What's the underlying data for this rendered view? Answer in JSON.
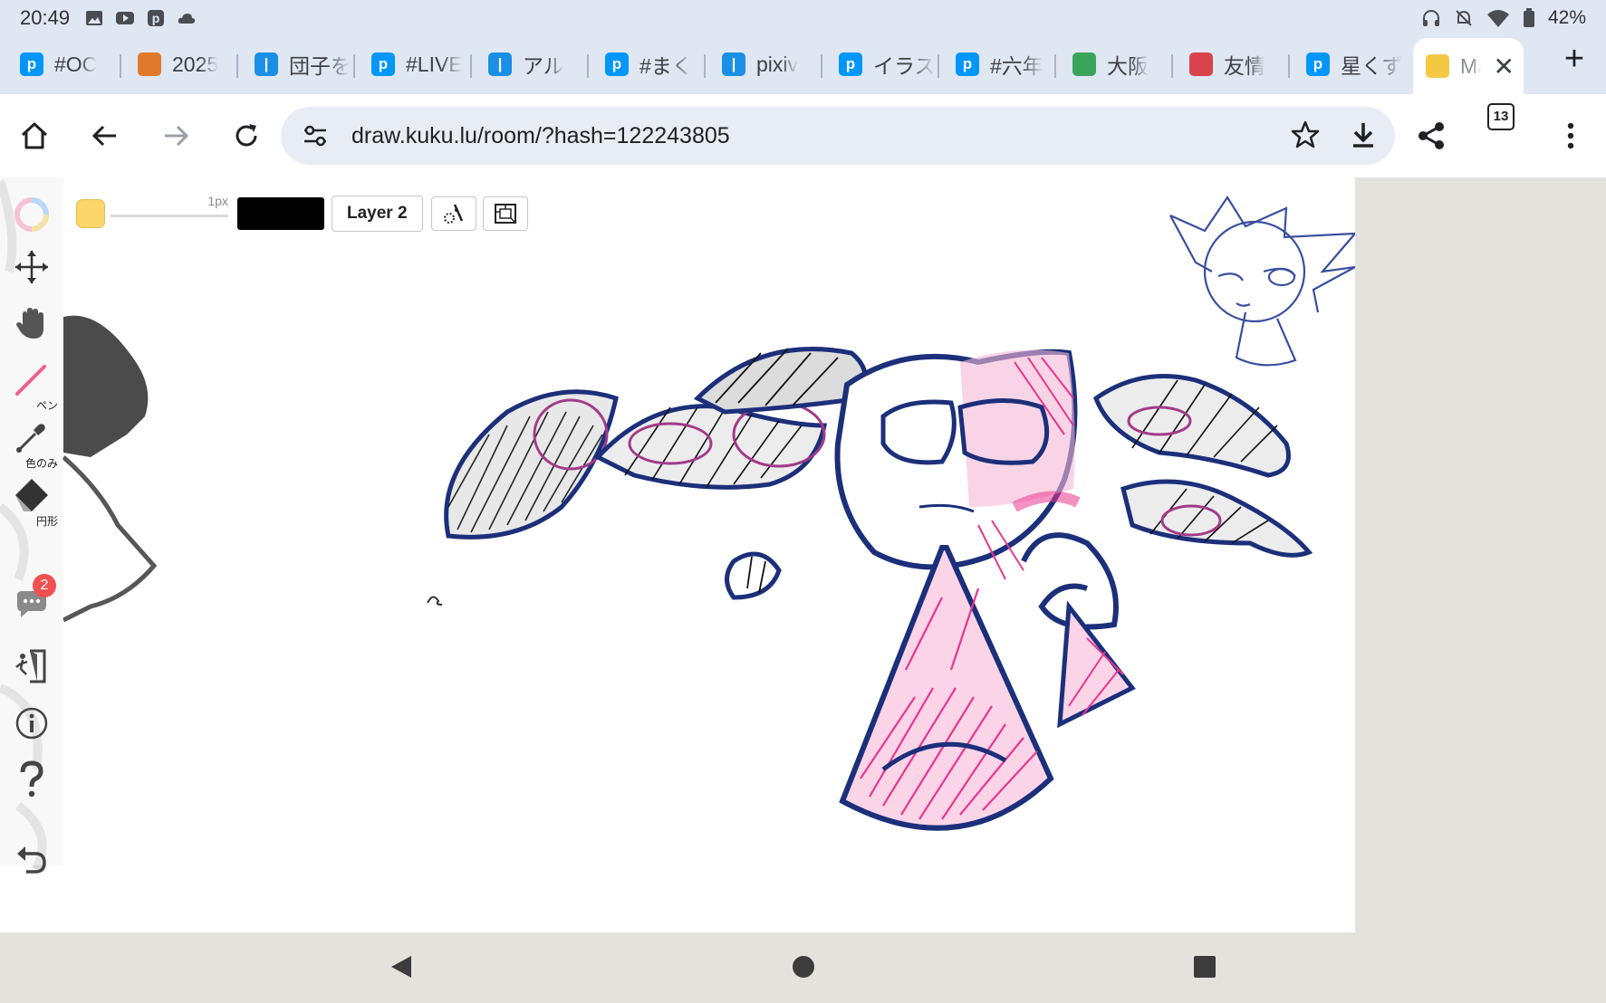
{
  "status_bar": {
    "time": "20:49",
    "battery": "42%"
  },
  "tabs": [
    {
      "title": "#OC",
      "fav_color": "#0096fa",
      "fav_glyph": "p"
    },
    {
      "title": "2025",
      "fav_color": "#e07a2a",
      "fav_glyph": ""
    },
    {
      "title": "団子を",
      "fav_color": "#1a8fe6",
      "fav_glyph": ""
    },
    {
      "title": "#LIVE",
      "fav_color": "#0096fa",
      "fav_glyph": "p"
    },
    {
      "title": "アル",
      "fav_color": "#1a8fe6",
      "fav_glyph": ""
    },
    {
      "title": "#まく",
      "fav_color": "#0096fa",
      "fav_glyph": "p"
    },
    {
      "title": "pixiv",
      "fav_color": "#1a8fe6",
      "fav_glyph": ""
    },
    {
      "title": "イラス",
      "fav_color": "#0096fa",
      "fav_glyph": "p"
    },
    {
      "title": "#六年",
      "fav_color": "#0096fa",
      "fav_glyph": "p"
    },
    {
      "title": "大阪",
      "fav_color": "#3aa55a",
      "fav_glyph": ""
    },
    {
      "title": "友情",
      "fav_color": "#d9434b",
      "fav_glyph": ""
    },
    {
      "title": "星くず",
      "fav_color": "#0096fa",
      "fav_glyph": "p"
    }
  ],
  "active_tab": {
    "title": "Ma",
    "fav_color": "#f4c842"
  },
  "address_bar": {
    "url": "draw.kuku.lu/room/?hash=122243805"
  },
  "tab_count": "13",
  "draw_toolbar": {
    "brush_size": "1px",
    "layer_label": "Layer 2",
    "current_color": "#000000",
    "palette_color": "#fbd66b"
  },
  "left_tools": {
    "pen_label": "ペン",
    "eyedropper_label": "色のみ",
    "shape_label": "円形",
    "chat_badge": "2"
  }
}
